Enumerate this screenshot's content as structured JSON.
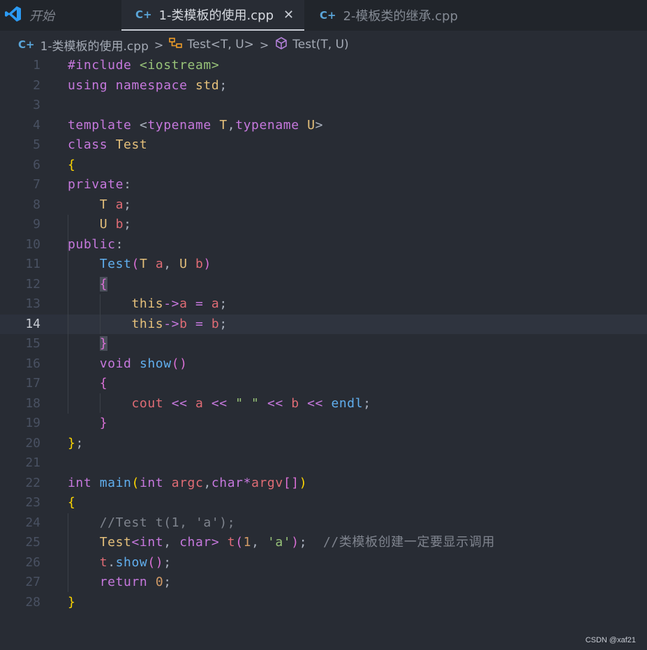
{
  "tabs": {
    "start": "开始",
    "active": "1-类模板的使用.cpp",
    "close_symbol": "✕",
    "inactive": "2-模板类的继承.cpp",
    "cpp_icon": "C+"
  },
  "breadcrumb": {
    "file": "1-类模板的使用.cpp",
    "class": "Test<T, U>",
    "method": "Test(T, U)",
    "separator": ">"
  },
  "editor": {
    "current_line": 14,
    "line_numbers": [
      "1",
      "2",
      "3",
      "4",
      "5",
      "6",
      "7",
      "8",
      "9",
      "10",
      "11",
      "12",
      "13",
      "14",
      "15",
      "16",
      "17",
      "18",
      "19",
      "20",
      "21",
      "22",
      "23",
      "24",
      "25",
      "26",
      "27",
      "28"
    ],
    "lines": [
      "#include <iostream>",
      "using namespace std;",
      "",
      "template <typename T,typename U>",
      "class Test",
      "{",
      "private:",
      "    T a;",
      "    U b;",
      "public:",
      "    Test(T a, U b)",
      "    {",
      "        this->a = a;",
      "        this->b = b;",
      "    }",
      "    void show()",
      "    {",
      "        cout << a << \" \" << b << endl;",
      "    }",
      "};",
      "",
      "int main(int argc,char*argv[])",
      "{",
      "    //Test t(1, 'a');",
      "    Test<int, char> t(1, 'a');  //类模板创建一定要显示调用",
      "    t.show();",
      "    return 0;",
      "}"
    ]
  },
  "watermark": "CSDN @xaf21",
  "colors": {
    "background": "#282c34",
    "keyword": "#c678dd",
    "type": "#e5c07b",
    "function": "#61afef",
    "variable": "#e06c75",
    "string": "#98c379",
    "number": "#d19a66",
    "comment": "#7f848e"
  }
}
